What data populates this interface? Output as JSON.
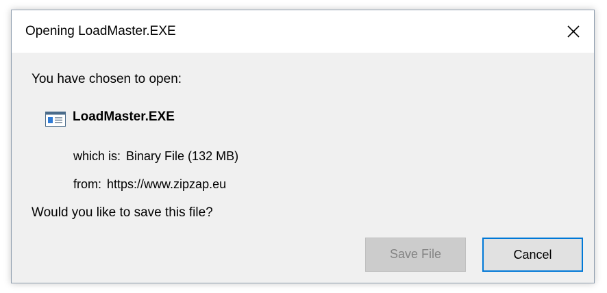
{
  "window": {
    "title": "Opening LoadMaster.EXE",
    "close_icon": "close-icon"
  },
  "dialog": {
    "prompt": "You have chosen to open:",
    "file_icon": "executable-file-icon",
    "file_name": "LoadMaster.EXE",
    "type_label": "which is:",
    "type_value": "Binary File (132 MB)",
    "source_label": "from:",
    "source_value": "https://www.zipzap.eu",
    "question": "Would you like to save this file?"
  },
  "buttons": {
    "save_label": "Save File",
    "save_enabled": false,
    "cancel_label": "Cancel",
    "cancel_focused": true
  },
  "colors": {
    "dialog_background": "#f0f0f0",
    "titlebar_background": "#ffffff",
    "focus_accent": "#0078d7",
    "disabled_button_background": "#cccccc",
    "disabled_text": "#838383"
  }
}
